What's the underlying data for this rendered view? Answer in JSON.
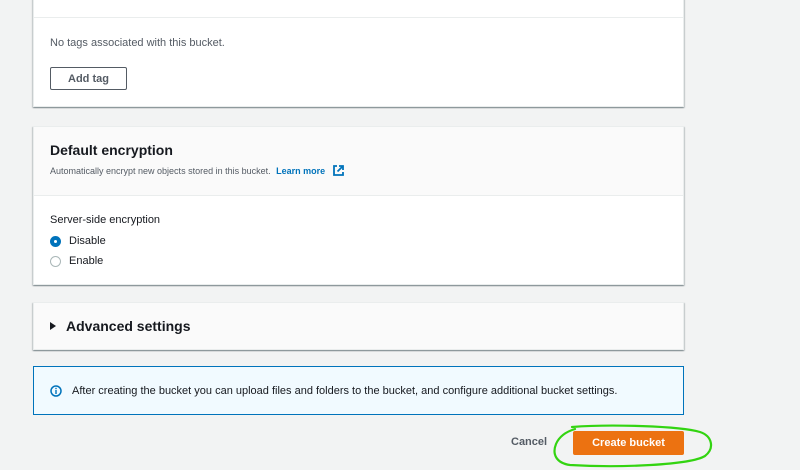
{
  "tags": {
    "empty_text": "No tags associated with this bucket.",
    "add_tag_label": "Add tag"
  },
  "encryption": {
    "title": "Default encryption",
    "description": "Automatically encrypt new objects stored in this bucket.",
    "learn_more": "Learn more",
    "field_label": "Server-side encryption",
    "options": [
      {
        "label": "Disable",
        "selected": true
      },
      {
        "label": "Enable",
        "selected": false
      }
    ]
  },
  "advanced": {
    "title": "Advanced settings",
    "expanded": false
  },
  "alert": {
    "text": "After creating the bucket you can upload files and folders to the bucket, and configure additional bucket settings."
  },
  "footer": {
    "cancel_label": "Cancel",
    "create_label": "Create bucket"
  },
  "colors": {
    "primary": "#ec7211",
    "link": "#0073bb",
    "annotation": "#33d411"
  },
  "icons": {
    "external_link": "external-link-icon",
    "info": "info-icon",
    "caret": "caret-right-icon"
  }
}
